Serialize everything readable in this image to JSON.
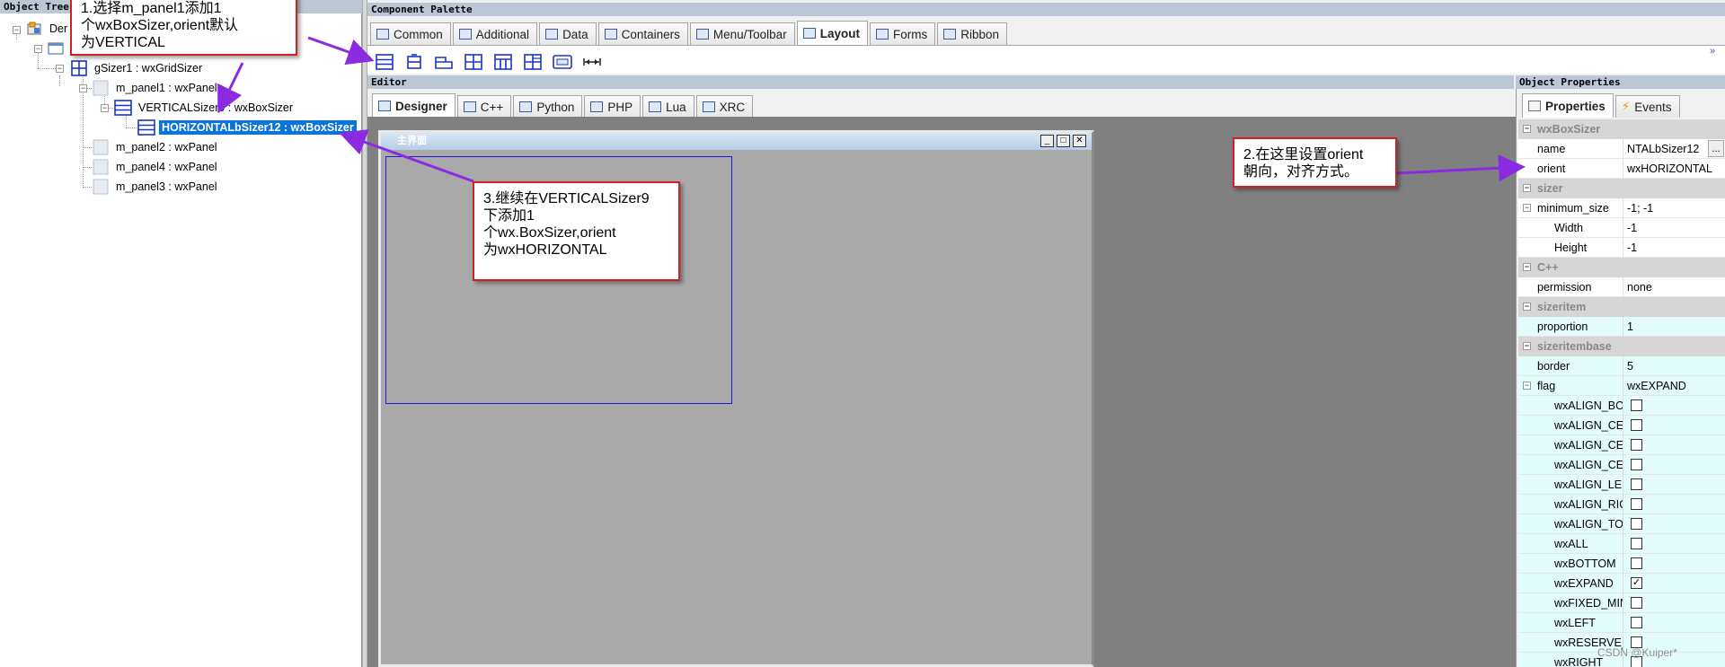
{
  "tree": {
    "header": "Object Tree",
    "root_label": "Der",
    "items": [
      {
        "label": "gSizer1 : wxGridSizer"
      },
      {
        "label": "m_panel1 : wxPanel"
      },
      {
        "label": "VERTICALSizer9 : wxBoxSizer"
      },
      {
        "label": "HORIZONTALbSizer12 : wxBoxSizer"
      },
      {
        "label": "m_panel2 : wxPanel"
      },
      {
        "label": "m_panel4 : wxPanel"
      },
      {
        "label": "m_panel3 : wxPanel"
      }
    ]
  },
  "palette": {
    "header": "Component Palette",
    "tabs": [
      "Common",
      "Additional",
      "Data",
      "Containers",
      "Menu/Toolbar",
      "Layout",
      "Forms",
      "Ribbon"
    ],
    "active_tab": "Layout",
    "tool_icons": [
      "box-sizer-icon",
      "wrap-sizer-icon",
      "static-box-sizer-icon",
      "grid-sizer-icon",
      "flex-grid-sizer-icon",
      "grid-bag-sizer-icon",
      "std-dialog-button-sizer-icon",
      "spacer-icon"
    ],
    "more": "»"
  },
  "editor": {
    "header": "Editor",
    "tabs": [
      "Designer",
      "C++",
      "Python",
      "PHP",
      "Lua",
      "XRC"
    ],
    "active_tab": "Designer",
    "frame_title": "主界面"
  },
  "properties": {
    "header": "Object Properties",
    "tabs": [
      "Properties",
      "Events"
    ],
    "rows": [
      {
        "kind": "cat",
        "name": "wxBoxSizer"
      },
      {
        "kind": "prop",
        "name": "name",
        "value": "NTALbSizer12",
        "button": "..."
      },
      {
        "kind": "prop",
        "name": "orient",
        "value": "wxHORIZONTAL"
      },
      {
        "kind": "cat",
        "name": "sizer"
      },
      {
        "kind": "prop",
        "name": "minimum_size",
        "value": "-1; -1",
        "expander": true
      },
      {
        "kind": "sub",
        "name": "Width",
        "value": "-1"
      },
      {
        "kind": "sub",
        "name": "Height",
        "value": "-1"
      },
      {
        "kind": "cat",
        "name": "C++"
      },
      {
        "kind": "prop",
        "name": "permission",
        "value": "none"
      },
      {
        "kind": "cat",
        "name": "sizeritem"
      },
      {
        "kind": "cyan",
        "name": "proportion",
        "value": "1"
      },
      {
        "kind": "cat",
        "name": "sizeritembase"
      },
      {
        "kind": "cyan",
        "name": "border",
        "value": "5"
      },
      {
        "kind": "cyan",
        "name": "flag",
        "value": "wxEXPAND",
        "expander": true
      },
      {
        "kind": "flag",
        "name": "wxALIGN_BO",
        "checked": false
      },
      {
        "kind": "flag",
        "name": "wxALIGN_CEI",
        "checked": false
      },
      {
        "kind": "flag",
        "name": "wxALIGN_CEI",
        "checked": false
      },
      {
        "kind": "flag",
        "name": "wxALIGN_CEI",
        "checked": false
      },
      {
        "kind": "flag",
        "name": "wxALIGN_LEF",
        "checked": false
      },
      {
        "kind": "flag",
        "name": "wxALIGN_RIG",
        "checked": false
      },
      {
        "kind": "flag",
        "name": "wxALIGN_TO",
        "checked": false
      },
      {
        "kind": "flag",
        "name": "wxALL",
        "checked": false
      },
      {
        "kind": "flag",
        "name": "wxBOTTOM",
        "checked": false
      },
      {
        "kind": "flag",
        "name": "wxEXPAND",
        "checked": true
      },
      {
        "kind": "flag",
        "name": "wxFIXED_MIN",
        "checked": false
      },
      {
        "kind": "flag",
        "name": "wxLEFT",
        "checked": false
      },
      {
        "kind": "flag",
        "name": "wxRESERVE_S",
        "checked": false
      },
      {
        "kind": "flag",
        "name": "wxRIGHT",
        "checked": false
      }
    ]
  },
  "annotations": {
    "callout1": [
      "1.选择m_panel1添加1",
      "个wxBoxSizer,orient默认",
      "为VERTICAL"
    ],
    "callout2": [
      "2.在这里设置orient",
      "朝向，对齐方式。"
    ],
    "callout3": [
      "3.继续在VERTICALSizer9",
      "下添加1",
      "个wx.BoxSizer,orient",
      "为wxHORIZONTAL"
    ],
    "watermark": "CSDN @Kuiper*"
  },
  "colors": {
    "selection": "#0a74da",
    "annotation_border": "#d21f1f",
    "arrow": "#8a2be2",
    "cyan_row": "#e3fdfd"
  }
}
